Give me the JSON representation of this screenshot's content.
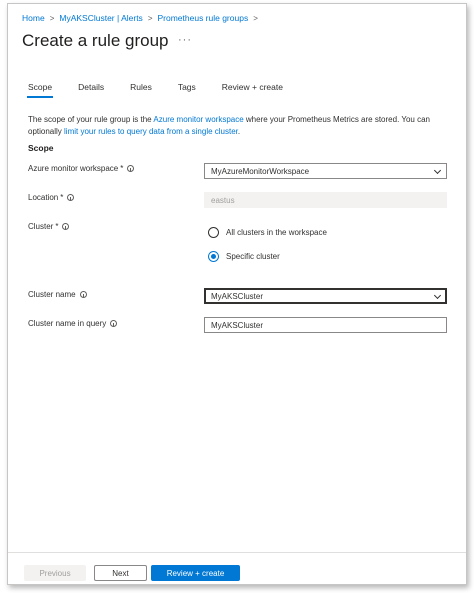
{
  "breadcrumb": {
    "items": [
      "Home",
      "MyAKSCluster | Alerts",
      "Prometheus rule groups"
    ],
    "separator": ">"
  },
  "page": {
    "title": "Create a rule group",
    "more_icon": "ellipsis-icon",
    "more_label": "···"
  },
  "tabs": [
    {
      "label": "Scope",
      "active": true
    },
    {
      "label": "Details",
      "active": false
    },
    {
      "label": "Rules",
      "active": false
    },
    {
      "label": "Tags",
      "active": false
    },
    {
      "label": "Review + create",
      "active": false
    }
  ],
  "description": {
    "part1": "The scope of your rule group is the ",
    "link1": "Azure monitor workspace",
    "part2": " where your Prometheus Metrics are stored. You can optionally ",
    "link2": "limit your rules to query data from a single cluster",
    "part3": "."
  },
  "section_title": "Scope",
  "form": {
    "workspace": {
      "label": "Azure monitor workspace",
      "required": "*",
      "value": "MyAzureMonitorWorkspace"
    },
    "location": {
      "label": "Location",
      "required": "*",
      "value": "eastus"
    },
    "cluster": {
      "label": "Cluster",
      "required": "*",
      "options": [
        {
          "label": "All clusters in the workspace",
          "checked": false
        },
        {
          "label": "Specific cluster",
          "checked": true
        }
      ]
    },
    "cluster_name": {
      "label": "Cluster name",
      "value": "MyAKSCluster"
    },
    "cluster_name_query": {
      "label": "Cluster name in query",
      "value": "MyAKSCluster"
    }
  },
  "footer": {
    "previous": "Previous",
    "next": "Next",
    "review": "Review + create"
  },
  "colors": {
    "accent": "#0078d4",
    "text": "#323130",
    "disabled_bg": "#f3f2f1",
    "disabled_text": "#a19f9d"
  }
}
